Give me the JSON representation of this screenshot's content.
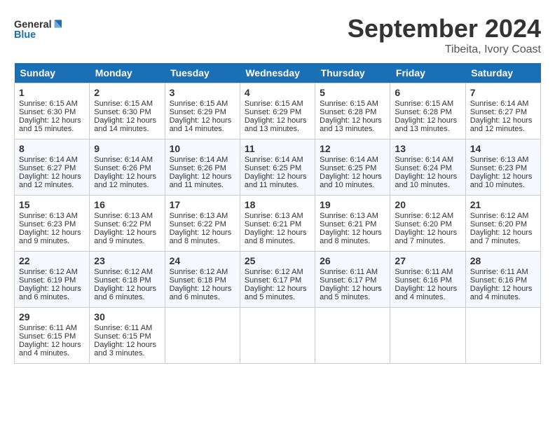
{
  "header": {
    "logo_general": "General",
    "logo_blue": "Blue",
    "month_title": "September 2024",
    "location": "Tibeita, Ivory Coast"
  },
  "days_of_week": [
    "Sunday",
    "Monday",
    "Tuesday",
    "Wednesday",
    "Thursday",
    "Friday",
    "Saturday"
  ],
  "weeks": [
    [
      {
        "day": 1,
        "lines": [
          "Sunrise: 6:15 AM",
          "Sunset: 6:30 PM",
          "Daylight: 12 hours",
          "and 15 minutes."
        ]
      },
      {
        "day": 2,
        "lines": [
          "Sunrise: 6:15 AM",
          "Sunset: 6:30 PM",
          "Daylight: 12 hours",
          "and 14 minutes."
        ]
      },
      {
        "day": 3,
        "lines": [
          "Sunrise: 6:15 AM",
          "Sunset: 6:29 PM",
          "Daylight: 12 hours",
          "and 14 minutes."
        ]
      },
      {
        "day": 4,
        "lines": [
          "Sunrise: 6:15 AM",
          "Sunset: 6:29 PM",
          "Daylight: 12 hours",
          "and 13 minutes."
        ]
      },
      {
        "day": 5,
        "lines": [
          "Sunrise: 6:15 AM",
          "Sunset: 6:28 PM",
          "Daylight: 12 hours",
          "and 13 minutes."
        ]
      },
      {
        "day": 6,
        "lines": [
          "Sunrise: 6:15 AM",
          "Sunset: 6:28 PM",
          "Daylight: 12 hours",
          "and 13 minutes."
        ]
      },
      {
        "day": 7,
        "lines": [
          "Sunrise: 6:14 AM",
          "Sunset: 6:27 PM",
          "Daylight: 12 hours",
          "and 12 minutes."
        ]
      }
    ],
    [
      {
        "day": 8,
        "lines": [
          "Sunrise: 6:14 AM",
          "Sunset: 6:27 PM",
          "Daylight: 12 hours",
          "and 12 minutes."
        ]
      },
      {
        "day": 9,
        "lines": [
          "Sunrise: 6:14 AM",
          "Sunset: 6:26 PM",
          "Daylight: 12 hours",
          "and 12 minutes."
        ]
      },
      {
        "day": 10,
        "lines": [
          "Sunrise: 6:14 AM",
          "Sunset: 6:26 PM",
          "Daylight: 12 hours",
          "and 11 minutes."
        ]
      },
      {
        "day": 11,
        "lines": [
          "Sunrise: 6:14 AM",
          "Sunset: 6:25 PM",
          "Daylight: 12 hours",
          "and 11 minutes."
        ]
      },
      {
        "day": 12,
        "lines": [
          "Sunrise: 6:14 AM",
          "Sunset: 6:25 PM",
          "Daylight: 12 hours",
          "and 10 minutes."
        ]
      },
      {
        "day": 13,
        "lines": [
          "Sunrise: 6:14 AM",
          "Sunset: 6:24 PM",
          "Daylight: 12 hours",
          "and 10 minutes."
        ]
      },
      {
        "day": 14,
        "lines": [
          "Sunrise: 6:13 AM",
          "Sunset: 6:23 PM",
          "Daylight: 12 hours",
          "and 10 minutes."
        ]
      }
    ],
    [
      {
        "day": 15,
        "lines": [
          "Sunrise: 6:13 AM",
          "Sunset: 6:23 PM",
          "Daylight: 12 hours",
          "and 9 minutes."
        ]
      },
      {
        "day": 16,
        "lines": [
          "Sunrise: 6:13 AM",
          "Sunset: 6:22 PM",
          "Daylight: 12 hours",
          "and 9 minutes."
        ]
      },
      {
        "day": 17,
        "lines": [
          "Sunrise: 6:13 AM",
          "Sunset: 6:22 PM",
          "Daylight: 12 hours",
          "and 8 minutes."
        ]
      },
      {
        "day": 18,
        "lines": [
          "Sunrise: 6:13 AM",
          "Sunset: 6:21 PM",
          "Daylight: 12 hours",
          "and 8 minutes."
        ]
      },
      {
        "day": 19,
        "lines": [
          "Sunrise: 6:13 AM",
          "Sunset: 6:21 PM",
          "Daylight: 12 hours",
          "and 8 minutes."
        ]
      },
      {
        "day": 20,
        "lines": [
          "Sunrise: 6:12 AM",
          "Sunset: 6:20 PM",
          "Daylight: 12 hours",
          "and 7 minutes."
        ]
      },
      {
        "day": 21,
        "lines": [
          "Sunrise: 6:12 AM",
          "Sunset: 6:20 PM",
          "Daylight: 12 hours",
          "and 7 minutes."
        ]
      }
    ],
    [
      {
        "day": 22,
        "lines": [
          "Sunrise: 6:12 AM",
          "Sunset: 6:19 PM",
          "Daylight: 12 hours",
          "and 6 minutes."
        ]
      },
      {
        "day": 23,
        "lines": [
          "Sunrise: 6:12 AM",
          "Sunset: 6:18 PM",
          "Daylight: 12 hours",
          "and 6 minutes."
        ]
      },
      {
        "day": 24,
        "lines": [
          "Sunrise: 6:12 AM",
          "Sunset: 6:18 PM",
          "Daylight: 12 hours",
          "and 6 minutes."
        ]
      },
      {
        "day": 25,
        "lines": [
          "Sunrise: 6:12 AM",
          "Sunset: 6:17 PM",
          "Daylight: 12 hours",
          "and 5 minutes."
        ]
      },
      {
        "day": 26,
        "lines": [
          "Sunrise: 6:11 AM",
          "Sunset: 6:17 PM",
          "Daylight: 12 hours",
          "and 5 minutes."
        ]
      },
      {
        "day": 27,
        "lines": [
          "Sunrise: 6:11 AM",
          "Sunset: 6:16 PM",
          "Daylight: 12 hours",
          "and 4 minutes."
        ]
      },
      {
        "day": 28,
        "lines": [
          "Sunrise: 6:11 AM",
          "Sunset: 6:16 PM",
          "Daylight: 12 hours",
          "and 4 minutes."
        ]
      }
    ],
    [
      {
        "day": 29,
        "lines": [
          "Sunrise: 6:11 AM",
          "Sunset: 6:15 PM",
          "Daylight: 12 hours",
          "and 4 minutes."
        ]
      },
      {
        "day": 30,
        "lines": [
          "Sunrise: 6:11 AM",
          "Sunset: 6:15 PM",
          "Daylight: 12 hours",
          "and 3 minutes."
        ]
      },
      null,
      null,
      null,
      null,
      null
    ]
  ]
}
